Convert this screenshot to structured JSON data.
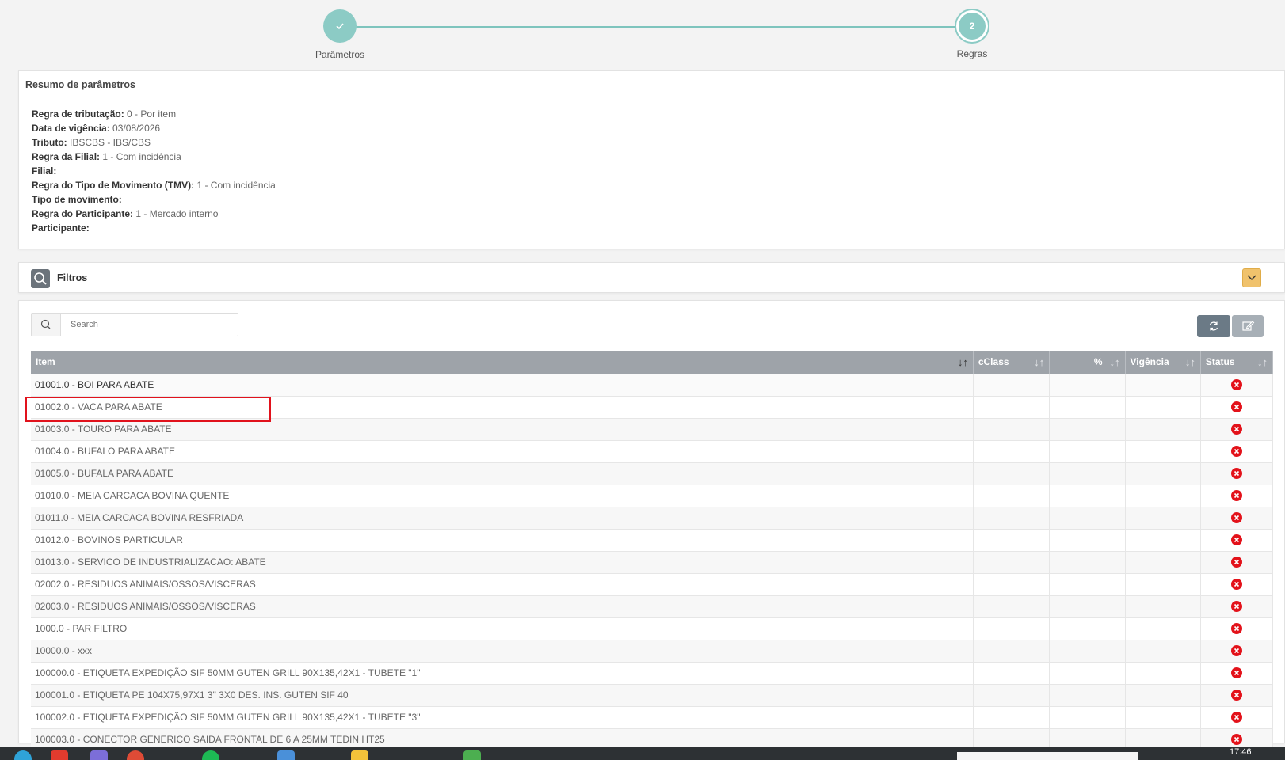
{
  "stepper": {
    "steps": [
      {
        "label": "Parâmetros",
        "icon": "check-icon"
      },
      {
        "label": "Regras",
        "number": "2"
      }
    ]
  },
  "summary": {
    "title": "Resumo de parâmetros",
    "fields": [
      {
        "key": "Regra de tributação:",
        "value": "0 - Por item"
      },
      {
        "key": "Data de vigência:",
        "value": "03/08/2026"
      },
      {
        "key": "Tributo:",
        "value": "IBSCBS - IBS/CBS"
      },
      {
        "key": "Regra da Filial:",
        "value": "1 - Com incidência"
      },
      {
        "key": "Filial:",
        "value": ""
      },
      {
        "key": "Regra do Tipo de Movimento (TMV):",
        "value": "1 - Com incidência"
      },
      {
        "key": "Tipo de movimento:",
        "value": ""
      },
      {
        "key": "Regra do Participante:",
        "value": "1 - Mercado interno"
      },
      {
        "key": "Participante:",
        "value": ""
      }
    ]
  },
  "filters": {
    "label": "Filtros",
    "icon": "search-icon",
    "toggle_icon": "chevron-down-icon"
  },
  "search": {
    "placeholder": "Search"
  },
  "toolbar": {
    "refresh_icon": "refresh-icon",
    "edit_icon": "edit-icon"
  },
  "table": {
    "columns": [
      "Item",
      "cClass",
      "%",
      "Vigência",
      "Status"
    ],
    "rows": [
      {
        "item": "01001.0 - BOI PARA ABATE",
        "cclass": "",
        "pct": "",
        "vigencia": "",
        "status": "error"
      },
      {
        "item": "01002.0 - VACA PARA ABATE",
        "cclass": "",
        "pct": "",
        "vigencia": "",
        "status": "error"
      },
      {
        "item": "01003.0 - TOURO PARA ABATE",
        "cclass": "",
        "pct": "",
        "vigencia": "",
        "status": "error"
      },
      {
        "item": "01004.0 - BUFALO PARA ABATE",
        "cclass": "",
        "pct": "",
        "vigencia": "",
        "status": "error"
      },
      {
        "item": "01005.0 - BUFALA PARA ABATE",
        "cclass": "",
        "pct": "",
        "vigencia": "",
        "status": "error"
      },
      {
        "item": "01010.0 - MEIA CARCACA BOVINA QUENTE",
        "cclass": "",
        "pct": "",
        "vigencia": "",
        "status": "error"
      },
      {
        "item": "01011.0 - MEIA CARCACA BOVINA RESFRIADA",
        "cclass": "",
        "pct": "",
        "vigencia": "",
        "status": "error"
      },
      {
        "item": "01012.0 - BOVINOS PARTICULAR",
        "cclass": "",
        "pct": "",
        "vigencia": "",
        "status": "error"
      },
      {
        "item": "01013.0 - SERVICO DE INDUSTRIALIZACAO: ABATE",
        "cclass": "",
        "pct": "",
        "vigencia": "",
        "status": "error"
      },
      {
        "item": "02002.0 - RESIDUOS ANIMAIS/OSSOS/VISCERAS",
        "cclass": "",
        "pct": "",
        "vigencia": "",
        "status": "error"
      },
      {
        "item": "02003.0 - RESIDUOS ANIMAIS/OSSOS/VISCERAS",
        "cclass": "",
        "pct": "",
        "vigencia": "",
        "status": "error"
      },
      {
        "item": "1000.0 - PAR FILTRO",
        "cclass": "",
        "pct": "",
        "vigencia": "",
        "status": "error"
      },
      {
        "item": "10000.0 - xxx",
        "cclass": "",
        "pct": "",
        "vigencia": "",
        "status": "error"
      },
      {
        "item": "100000.0 - ETIQUETA EXPEDIÇÃO SIF 50MM GUTEN GRILL 90X135,42X1 - TUBETE \"1\"",
        "cclass": "",
        "pct": "",
        "vigencia": "",
        "status": "error"
      },
      {
        "item": "100001.0 - ETIQUETA PE 104X75,97X1 3\" 3X0 DES. INS. GUTEN SIF 40",
        "cclass": "",
        "pct": "",
        "vigencia": "",
        "status": "error"
      },
      {
        "item": "100002.0 - ETIQUETA EXPEDIÇÃO SIF 50MM GUTEN GRILL 90X135,42X1 - TUBETE \"3\"",
        "cclass": "",
        "pct": "",
        "vigencia": "",
        "status": "error"
      },
      {
        "item": "100003.0 - CONECTOR GENERICO SAIDA FRONTAL DE 6 A 25MM TEDIN HT25",
        "cclass": "",
        "pct": "",
        "vigencia": "",
        "status": "error"
      }
    ]
  },
  "taskbar": {
    "clock": "17:46"
  },
  "colors": {
    "accent": "#8ccbc5",
    "header": "#9ea3a9",
    "error": "#e3121a",
    "highlight": "#e1121c",
    "filter_toggle": "#f0c26c"
  }
}
